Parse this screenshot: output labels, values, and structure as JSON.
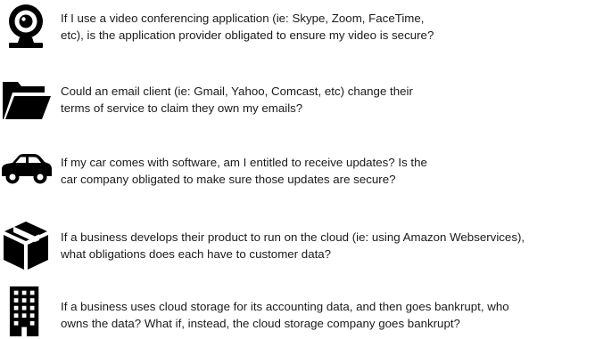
{
  "questions": [
    {
      "icon": "webcam-icon",
      "text": "If I use a video conferencing application (ie: Skype, Zoom, FaceTime,\netc), is the application provider obligated to ensure my video is secure?"
    },
    {
      "icon": "open-folder-icon",
      "text": "Could an email client (ie: Gmail, Yahoo, Comcast, etc) change their\nterms of service to claim they own my emails?"
    },
    {
      "icon": "car-icon",
      "text": "If my car comes with software, am I entitled to receive updates? Is the\ncar company obligated to make sure those updates are secure?"
    },
    {
      "icon": "package-box-icon",
      "text": "If a business develops their product to run on the cloud (ie: using Amazon Webservices),\nwhat obligations does each have to customer data?"
    },
    {
      "icon": "office-building-icon",
      "text": "If a business uses cloud storage for its accounting data, and then goes bankrupt, who\nowns the data? What if, instead, the cloud storage company goes bankrupt?"
    }
  ]
}
